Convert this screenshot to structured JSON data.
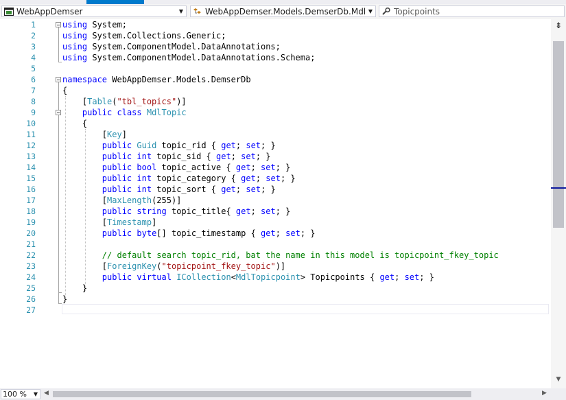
{
  "navbar": {
    "project": {
      "icon": "csharp-project-icon",
      "label": "WebAppDemser"
    },
    "class": {
      "icon": "class-icon",
      "label": "WebAppDemser.Models.DemserDb.MdlTopic"
    },
    "member": {
      "icon": "property-wrench-icon",
      "label": "Topicpoints"
    }
  },
  "editor": {
    "line_numbers": [
      "1",
      "2",
      "3",
      "4",
      "5",
      "6",
      "7",
      "8",
      "9",
      "10",
      "11",
      "12",
      "13",
      "14",
      "15",
      "16",
      "17",
      "18",
      "19",
      "20",
      "21",
      "22",
      "23",
      "24",
      "25",
      "26",
      "27"
    ],
    "lines": [
      [
        {
          "t": "using",
          "c": "kw"
        },
        {
          "t": " System;",
          "c": ""
        }
      ],
      [
        {
          "t": "using",
          "c": "kw"
        },
        {
          "t": " System.Collections.Generic;",
          "c": ""
        }
      ],
      [
        {
          "t": "using",
          "c": "kw"
        },
        {
          "t": " System.ComponentModel.DataAnnotations;",
          "c": ""
        }
      ],
      [
        {
          "t": "using",
          "c": "kw"
        },
        {
          "t": " System.ComponentModel.DataAnnotations.Schema;",
          "c": ""
        }
      ],
      [],
      [
        {
          "t": "namespace",
          "c": "kw"
        },
        {
          "t": " WebAppDemser.Models.DemserDb",
          "c": ""
        }
      ],
      [
        {
          "t": "{",
          "c": ""
        }
      ],
      [
        {
          "t": "    [",
          "c": ""
        },
        {
          "t": "Table",
          "c": "ty"
        },
        {
          "t": "(",
          "c": ""
        },
        {
          "t": "\"tbl_topics\"",
          "c": "st"
        },
        {
          "t": ")]",
          "c": ""
        }
      ],
      [
        {
          "t": "    ",
          "c": ""
        },
        {
          "t": "public",
          "c": "kw"
        },
        {
          "t": " ",
          "c": ""
        },
        {
          "t": "class",
          "c": "kw"
        },
        {
          "t": " ",
          "c": ""
        },
        {
          "t": "MdlTopic",
          "c": "ty"
        }
      ],
      [
        {
          "t": "    {",
          "c": ""
        }
      ],
      [
        {
          "t": "        [",
          "c": ""
        },
        {
          "t": "Key",
          "c": "ty"
        },
        {
          "t": "]",
          "c": ""
        }
      ],
      [
        {
          "t": "        ",
          "c": ""
        },
        {
          "t": "public",
          "c": "kw"
        },
        {
          "t": " ",
          "c": ""
        },
        {
          "t": "Guid",
          "c": "ty"
        },
        {
          "t": " topic_rid { ",
          "c": ""
        },
        {
          "t": "get",
          "c": "kw"
        },
        {
          "t": "; ",
          "c": ""
        },
        {
          "t": "set",
          "c": "kw"
        },
        {
          "t": "; }",
          "c": ""
        }
      ],
      [
        {
          "t": "        ",
          "c": ""
        },
        {
          "t": "public",
          "c": "kw"
        },
        {
          "t": " ",
          "c": ""
        },
        {
          "t": "int",
          "c": "kw"
        },
        {
          "t": " topic_sid { ",
          "c": ""
        },
        {
          "t": "get",
          "c": "kw"
        },
        {
          "t": "; ",
          "c": ""
        },
        {
          "t": "set",
          "c": "kw"
        },
        {
          "t": "; }",
          "c": ""
        }
      ],
      [
        {
          "t": "        ",
          "c": ""
        },
        {
          "t": "public",
          "c": "kw"
        },
        {
          "t": " ",
          "c": ""
        },
        {
          "t": "bool",
          "c": "kw"
        },
        {
          "t": " topic_active { ",
          "c": ""
        },
        {
          "t": "get",
          "c": "kw"
        },
        {
          "t": "; ",
          "c": ""
        },
        {
          "t": "set",
          "c": "kw"
        },
        {
          "t": "; }",
          "c": ""
        }
      ],
      [
        {
          "t": "        ",
          "c": ""
        },
        {
          "t": "public",
          "c": "kw"
        },
        {
          "t": " ",
          "c": ""
        },
        {
          "t": "int",
          "c": "kw"
        },
        {
          "t": " topic_category { ",
          "c": ""
        },
        {
          "t": "get",
          "c": "kw"
        },
        {
          "t": "; ",
          "c": ""
        },
        {
          "t": "set",
          "c": "kw"
        },
        {
          "t": "; }",
          "c": ""
        }
      ],
      [
        {
          "t": "        ",
          "c": ""
        },
        {
          "t": "public",
          "c": "kw"
        },
        {
          "t": " ",
          "c": ""
        },
        {
          "t": "int",
          "c": "kw"
        },
        {
          "t": " topic_sort { ",
          "c": ""
        },
        {
          "t": "get",
          "c": "kw"
        },
        {
          "t": "; ",
          "c": ""
        },
        {
          "t": "set",
          "c": "kw"
        },
        {
          "t": "; }",
          "c": ""
        }
      ],
      [
        {
          "t": "        [",
          "c": ""
        },
        {
          "t": "MaxLength",
          "c": "ty"
        },
        {
          "t": "(255)]",
          "c": ""
        }
      ],
      [
        {
          "t": "        ",
          "c": ""
        },
        {
          "t": "public",
          "c": "kw"
        },
        {
          "t": " ",
          "c": ""
        },
        {
          "t": "string",
          "c": "kw"
        },
        {
          "t": " topic_title{ ",
          "c": ""
        },
        {
          "t": "get",
          "c": "kw"
        },
        {
          "t": "; ",
          "c": ""
        },
        {
          "t": "set",
          "c": "kw"
        },
        {
          "t": "; }",
          "c": ""
        }
      ],
      [
        {
          "t": "        [",
          "c": ""
        },
        {
          "t": "Timestamp",
          "c": "ty"
        },
        {
          "t": "]",
          "c": ""
        }
      ],
      [
        {
          "t": "        ",
          "c": ""
        },
        {
          "t": "public",
          "c": "kw"
        },
        {
          "t": " ",
          "c": ""
        },
        {
          "t": "byte",
          "c": "kw"
        },
        {
          "t": "[] topic_timestamp { ",
          "c": ""
        },
        {
          "t": "get",
          "c": "kw"
        },
        {
          "t": "; ",
          "c": ""
        },
        {
          "t": "set",
          "c": "kw"
        },
        {
          "t": "; }",
          "c": ""
        }
      ],
      [],
      [
        {
          "t": "        // default search topic_rid, bat the name in this model is topicpoint_fkey_topic",
          "c": "cm"
        }
      ],
      [
        {
          "t": "        [",
          "c": ""
        },
        {
          "t": "ForeignKey",
          "c": "ty"
        },
        {
          "t": "(",
          "c": ""
        },
        {
          "t": "\"topicpoint_fkey_topic\"",
          "c": "st"
        },
        {
          "t": ")]",
          "c": ""
        }
      ],
      [
        {
          "t": "        ",
          "c": ""
        },
        {
          "t": "public",
          "c": "kw"
        },
        {
          "t": " ",
          "c": ""
        },
        {
          "t": "virtual",
          "c": "kw"
        },
        {
          "t": " ",
          "c": ""
        },
        {
          "t": "ICollection",
          "c": "ty"
        },
        {
          "t": "<",
          "c": ""
        },
        {
          "t": "MdlTopicpoint",
          "c": "ty"
        },
        {
          "t": "> Topicpoints { ",
          "c": ""
        },
        {
          "t": "get",
          "c": "kw"
        },
        {
          "t": "; ",
          "c": ""
        },
        {
          "t": "set",
          "c": "kw"
        },
        {
          "t": "; }",
          "c": ""
        }
      ],
      [
        {
          "t": "    }",
          "c": ""
        }
      ],
      [
        {
          "t": "}",
          "c": ""
        }
      ],
      []
    ]
  },
  "colors": {
    "keyword": "#0000ff",
    "type": "#2b91af",
    "string": "#a31515",
    "comment": "#008000",
    "line_number": "#2b91af",
    "accent": "#007acc"
  },
  "status": {
    "zoom": "100 %"
  },
  "scrollbar": {
    "vertical_position_fraction": 0.06,
    "horizontal_position_fraction": 0.0
  }
}
